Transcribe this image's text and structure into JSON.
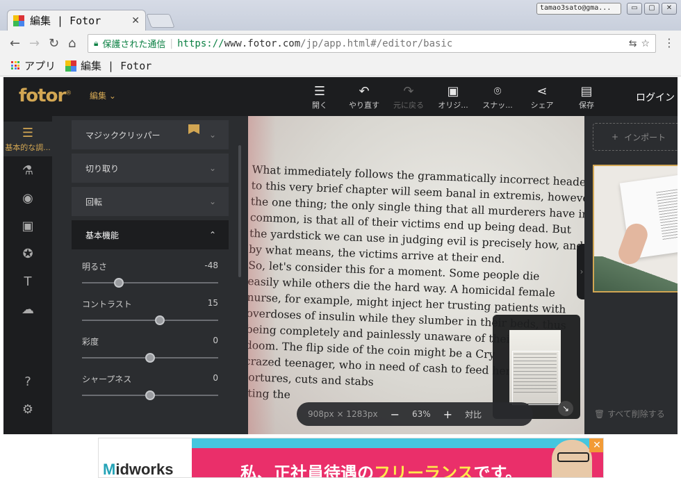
{
  "browser": {
    "tab_title": "編集 | Fotor",
    "tab_close": "✕",
    "profile": "tamao3sato@gma...",
    "secure_label": "保護された通信",
    "url_scheme": "https://",
    "url_host": "www.fotor.com",
    "url_path": "/jp/app.html#/editor/basic",
    "bookmarks": {
      "apps_label": "アプリ",
      "fotor_label": "編集 | Fotor"
    },
    "window_buttons": {
      "minimize": "▭",
      "maximize": "▢",
      "close": "✕"
    }
  },
  "app": {
    "logo": "fotor",
    "logo_mark": "®",
    "edit_menu": "編集",
    "header_tools": [
      {
        "label": "開く",
        "icon": "menu-icon"
      },
      {
        "label": "やり直す",
        "icon": "undo-icon"
      },
      {
        "label": "元に戻る",
        "icon": "redo-icon"
      },
      {
        "label": "オリジ...",
        "icon": "original-image-icon"
      },
      {
        "label": "スナッ...",
        "icon": "snapshot-icon"
      },
      {
        "label": "シェア",
        "icon": "share-icon"
      },
      {
        "label": "保存",
        "icon": "save-icon"
      }
    ],
    "login": "ログイン",
    "rail": {
      "active_label": "基本的な調..."
    },
    "panel": {
      "sections": [
        "マジッククリッパー",
        "切り取り",
        "回転",
        "基本機能"
      ],
      "sliders": [
        {
          "label": "明るさ",
          "value": "-48",
          "position": 0.27
        },
        {
          "label": "コントラスト",
          "value": "15",
          "position": 0.57
        },
        {
          "label": "彩度",
          "value": "0",
          "position": 0.5
        },
        {
          "label": "シャープネス",
          "value": "0",
          "position": 0.5
        }
      ]
    },
    "photo_lines": [
      "What immediately follows the grammatically incorrect header",
      "to this very brief chapter will seem banal in extremis, however,",
      "the one thing; the only single thing that all murderers have in",
      "common, is that all of their victims end up being dead. But",
      "the yardstick we can use in judging evil is precisely how, and",
      "by what means, the victims arrive at their end.",
      "   So, let's consider this for a moment. Some people die",
      "easily while others die the hard way. A homicidal female",
      "nurse, for example, might inject her trusting patients with",
      "overdoses of insulin while they slumber in their beds, thus",
      "being completely and painlessly unaware of their fate.",
      "doom. The flip side of the coin might be a Cry",
      "crazed teenager, who in need of cash to feed her h",
      "tortures, cuts and stabs",
      "tting the"
    ],
    "zoombar": {
      "dimensions": "908px × 1283px",
      "minus": "−",
      "zoom": "63%",
      "plus": "+",
      "compare": "対比"
    },
    "import_label": "インポート",
    "clear_all": "すべて削除する"
  },
  "ad": {
    "brand_m": "M",
    "brand_rest": "idworks",
    "headline_a": "私、正社員待遇の",
    "headline_b": "フリーランス",
    "headline_c": "です。",
    "close": "✕"
  }
}
